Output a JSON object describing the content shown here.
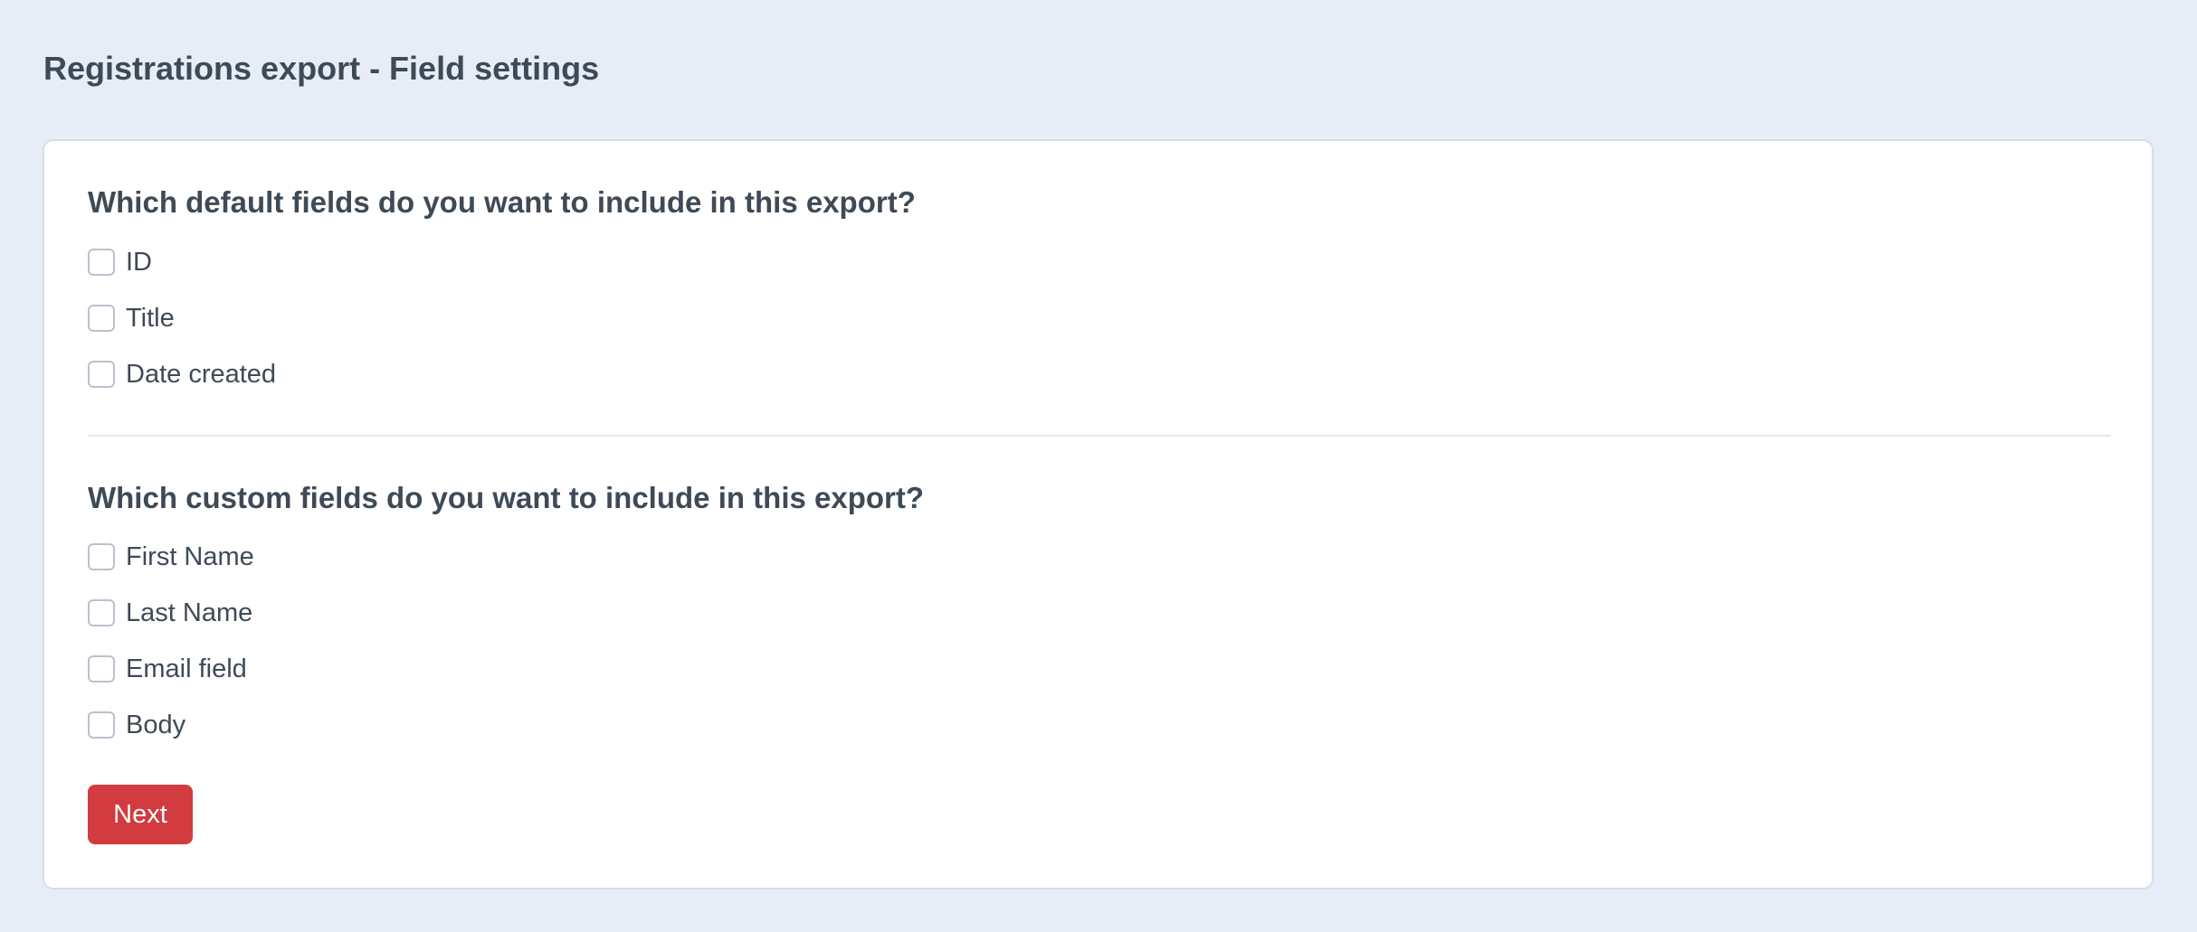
{
  "page": {
    "title": "Registrations export - Field settings"
  },
  "default_fields": {
    "heading": "Which default fields do you want to include in this export?",
    "options": [
      {
        "label": "ID",
        "checked": false
      },
      {
        "label": "Title",
        "checked": false
      },
      {
        "label": "Date created",
        "checked": false
      }
    ]
  },
  "custom_fields": {
    "heading": "Which custom fields do you want to include in this export?",
    "options": [
      {
        "label": "First Name",
        "checked": false
      },
      {
        "label": "Last Name",
        "checked": false
      },
      {
        "label": "Email field",
        "checked": false
      },
      {
        "label": "Body",
        "checked": false
      }
    ]
  },
  "actions": {
    "next_label": "Next"
  },
  "colors": {
    "background": "#e6edf6",
    "card": "#ffffff",
    "text": "#3f4a57",
    "checkbox_border": "#b8c2cf",
    "primary_button": "#d23b3f"
  }
}
